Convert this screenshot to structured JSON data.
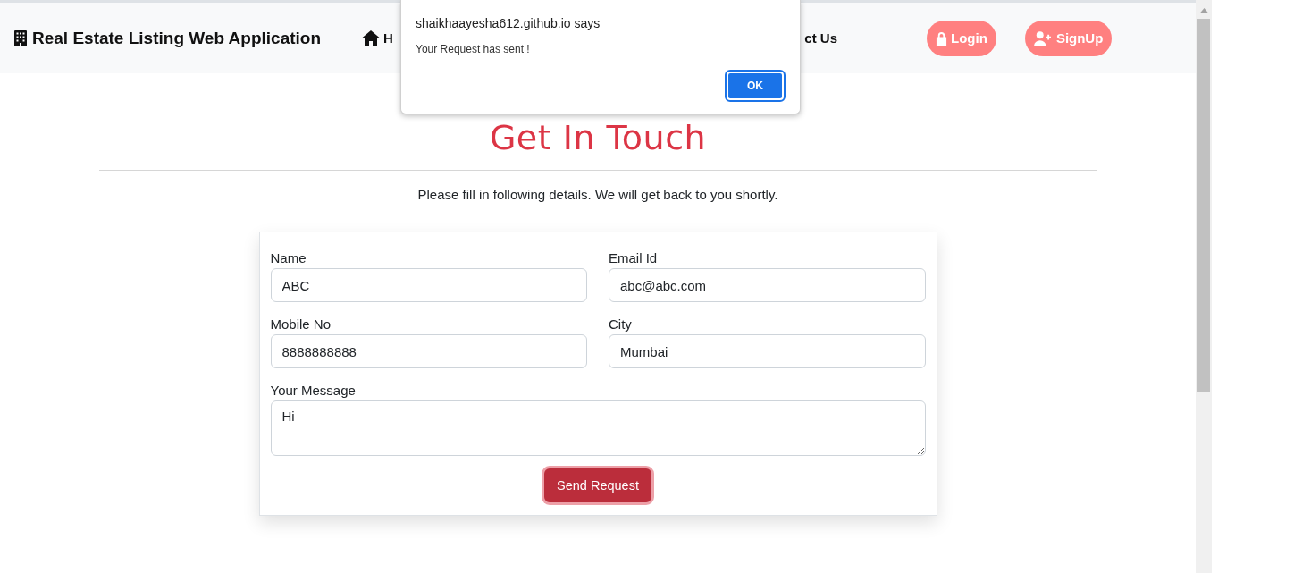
{
  "navbar": {
    "brand": "Real Estate Listing Web Application",
    "links": [
      {
        "label": "H"
      },
      {
        "label": "ct Us"
      }
    ],
    "buttons": [
      {
        "label": "Login"
      },
      {
        "label": "SignUp"
      }
    ]
  },
  "dialog": {
    "title": "shaikhaayesha612.github.io says",
    "message": "Your Request has sent !",
    "button": "OK"
  },
  "heading": "Get In Touch",
  "intro": "Please fill in following details. We will get back to you shortly.",
  "form": {
    "fields": [
      {
        "label": "Name",
        "value": "ABC",
        "kind": "input"
      },
      {
        "label": "Email Id",
        "value": "abc@abc.com",
        "kind": "input"
      },
      {
        "label": "Mobile No",
        "value": "8888888888",
        "kind": "input"
      },
      {
        "label": "City",
        "value": "Mumbai",
        "kind": "input"
      },
      {
        "label": "Your Message",
        "value": "Hi",
        "kind": "textarea"
      }
    ],
    "submit": "Send Request"
  }
}
